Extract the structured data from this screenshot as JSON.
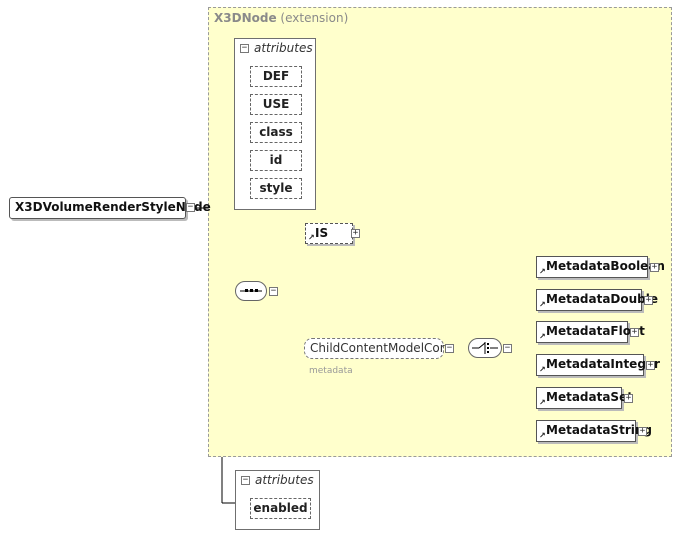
{
  "extension": {
    "name": "X3DNode",
    "kind": "(extension)"
  },
  "root": {
    "name": "X3DVolumeRenderStyleNode"
  },
  "inherited_attributes": {
    "label": "attributes",
    "items": [
      "DEF",
      "USE",
      "class",
      "id",
      "style"
    ]
  },
  "sequence_children": {
    "is_node": "IS",
    "core_group": {
      "name": "ChildContentModelCore",
      "sub": "metadata"
    },
    "choice_items": [
      "MetadataBoolean",
      "MetadataDouble",
      "MetadataFloat",
      "MetadataInteger",
      "MetadataSet",
      "MetadataString"
    ]
  },
  "own_attributes": {
    "label": "attributes",
    "items": [
      "enabled"
    ]
  },
  "colors": {
    "extension_bg": "#ffffcc",
    "border": "#6f6f6f",
    "line": "#000000"
  }
}
